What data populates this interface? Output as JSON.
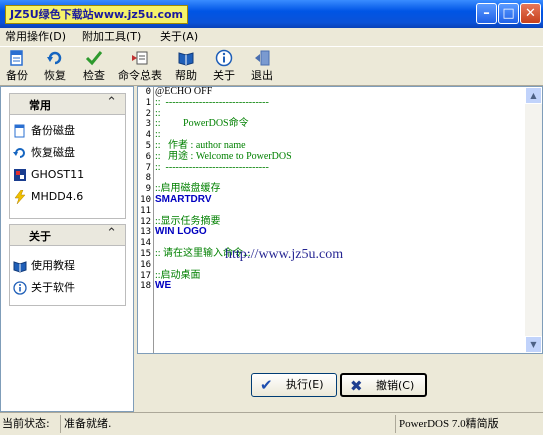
{
  "window": {
    "title": "JZ5U绿色下载站www.jz5u.com",
    "min_glyph": "–",
    "max_glyph": "□",
    "close_glyph": "✕"
  },
  "menu": [
    {
      "label": "常用操作(D)"
    },
    {
      "label": "附加工具(T)"
    },
    {
      "label": "关于(A)"
    }
  ],
  "toolbar": [
    {
      "label": "备份",
      "icon": "backup-icon",
      "color": "#2a6fd1"
    },
    {
      "label": "恢复",
      "icon": "restore-icon",
      "color": "#1565c0"
    },
    {
      "label": "检查",
      "icon": "check-icon",
      "color": "#2e9a2e"
    },
    {
      "label": "命令总表",
      "icon": "command-list-icon",
      "color": "#c03030"
    },
    {
      "label": "帮助",
      "icon": "help-book-icon",
      "color": "#1f5fb8"
    },
    {
      "label": "关于",
      "icon": "info-icon",
      "color": "#1f5fb8"
    },
    {
      "label": "退出",
      "icon": "exit-icon",
      "color": "#4a6fb0"
    }
  ],
  "sidebar": {
    "groups": [
      {
        "title": "常用",
        "chevron": "⌃",
        "items": [
          {
            "label": "备份磁盘",
            "icon": "backup-disk-icon"
          },
          {
            "label": "恢复磁盘",
            "icon": "restore-disk-icon"
          },
          {
            "label": "GHOST11",
            "icon": "ghost-icon"
          },
          {
            "label": "MHDD4.6",
            "icon": "lightning-icon"
          }
        ]
      },
      {
        "title": "关于",
        "chevron": "⌃",
        "items": [
          {
            "label": "使用教程",
            "icon": "tutorial-book-icon"
          },
          {
            "label": "关于软件",
            "icon": "about-info-icon"
          }
        ]
      }
    ]
  },
  "editor": {
    "line_numbers": [
      "0",
      "1",
      "2",
      "3",
      "4",
      "5",
      "6",
      "7",
      "8",
      "9",
      "10",
      "11",
      "12",
      "13",
      "14",
      "15",
      "16",
      "17",
      "18"
    ],
    "lines": [
      {
        "text": "@ECHO OFF",
        "cls": "plain"
      },
      {
        "text": "::  -------------------------------",
        "cls": "cmt"
      },
      {
        "text": "::",
        "cls": "cmt"
      },
      {
        "text": "::         PowerDOS命令",
        "cls": "cmt"
      },
      {
        "text": "::",
        "cls": "cmt"
      },
      {
        "text": "::   作者 : author name",
        "cls": "cmt"
      },
      {
        "text": "::   用途 : Welcome to PowerDOS",
        "cls": "cmt"
      },
      {
        "text": "::  -------------------------------",
        "cls": "cmt"
      },
      {
        "text": "",
        "cls": "plain"
      },
      {
        "text": "::启用磁盘缓存",
        "cls": "cmt"
      },
      {
        "text": "SMARTDRV",
        "cls": "kw"
      },
      {
        "text": "",
        "cls": "plain"
      },
      {
        "text": "::显示任务摘要",
        "cls": "cmt"
      },
      {
        "text": "WIN LOGO",
        "cls": "kw"
      },
      {
        "text": "",
        "cls": "plain"
      },
      {
        "text": ":: 请在这里输入命令...",
        "cls": "cmt"
      },
      {
        "text": "",
        "cls": "plain"
      },
      {
        "text": "::启动桌面",
        "cls": "cmt"
      },
      {
        "text": "WE",
        "cls": "kw"
      }
    ],
    "watermark": "http://www.jz5u.com"
  },
  "buttons": {
    "execute": {
      "label": "执行(E)",
      "icon": "✔"
    },
    "cancel": {
      "label": "撤销(C)",
      "icon": "✖"
    }
  },
  "status": {
    "label": "当前状态:",
    "value": "准备就绪.",
    "version": "PowerDOS 7.0精简版"
  }
}
